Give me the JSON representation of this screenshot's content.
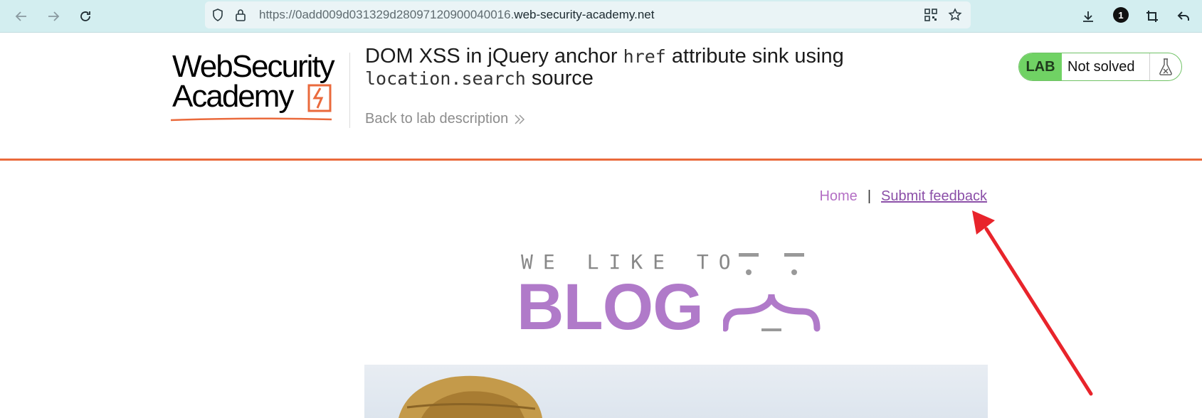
{
  "browser": {
    "url_prefix": "https://0add009d031329d28097120900040016.",
    "url_host": "web-security-academy.net",
    "extension_badge": "1"
  },
  "lab": {
    "logo_line1": "WebSecurity",
    "logo_line2": "Academy",
    "title_part1": "DOM XSS in jQuery anchor ",
    "title_code1": "href",
    "title_part2": " attribute sink using",
    "title_code2": "location.search",
    "title_part3": " source",
    "back_link": "Back to lab description",
    "status_tag": "LAB",
    "status_text": "Not solved"
  },
  "nav": {
    "home": "Home",
    "separator": "|",
    "feedback": "Submit feedback"
  },
  "blog": {
    "tagline": "WE LIKE TO",
    "word": "BLOG"
  },
  "colors": {
    "accent_orange": "#ea6a3c",
    "blog_purple": "#b07ac9",
    "lab_green": "#70d264",
    "arrow_red": "#e8242b"
  }
}
